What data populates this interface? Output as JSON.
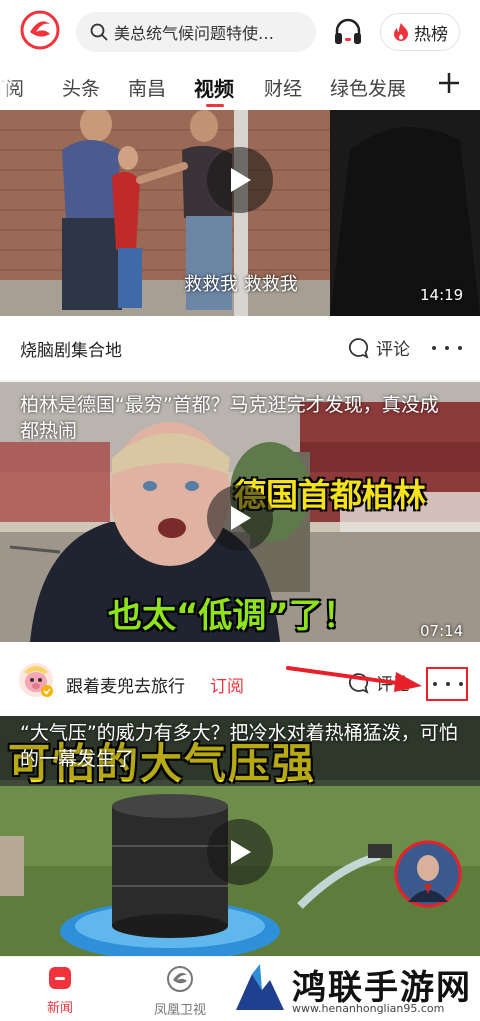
{
  "header": {
    "search_text": "美总统气候问题特使…",
    "hot_label": "热榜"
  },
  "tabs": [
    {
      "label": "订阅"
    },
    {
      "label": "头条"
    },
    {
      "label": "南昌"
    },
    {
      "label": "视频"
    },
    {
      "label": "财经"
    },
    {
      "label": "绿色发展"
    }
  ],
  "videos": [
    {
      "subtitle": "救救我 救救我",
      "duration": "14:19",
      "source": "烧脑剧集合地",
      "comment_label": "评论"
    },
    {
      "title": "柏林是德国“最穷”首都？马克逛完才发现，真没成都热闹",
      "caption_top": "德国首都柏林",
      "caption_bottom": "也太“低调”了！",
      "duration": "07:14",
      "source": "跟着麦兜去旅行",
      "subscribe_label": "订阅",
      "comment_label": "评论"
    },
    {
      "title": "“大气压”的威力有多大？把冷水对着热桶猛泼，可怕的一幕发生了",
      "caption": "可怕的大气压强"
    }
  ],
  "bottom_nav": [
    {
      "label": "新闻"
    },
    {
      "label": "凤凰卫视"
    }
  ],
  "watermark": {
    "title": "鸿联手游网",
    "url": "www.henanhonglian95.com"
  },
  "colors": {
    "brand_red": "#f2333c",
    "annotation_red": "#e8202a"
  }
}
